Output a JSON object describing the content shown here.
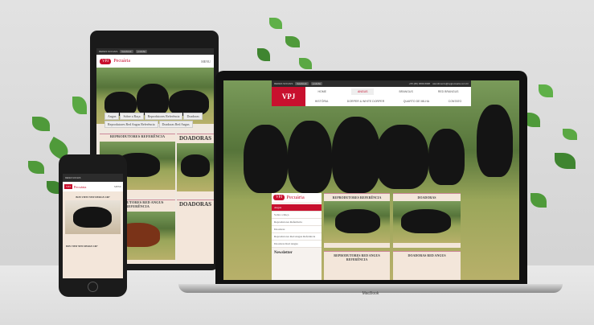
{
  "site": {
    "brand": "VPJ",
    "brand_sub": "Pecuária",
    "topbar_label": "REDES SOCIAIS",
    "facebook": "facebook",
    "youtube": "youtube",
    "phone": "+55 (##) 3###-####",
    "email": "atendimento@vpjpecuaria.com.br"
  },
  "laptop": {
    "label": "MacBook",
    "nav_row1": [
      "HOME",
      "ANGUS",
      "BRANGUS",
      "RED BRANGUS"
    ],
    "nav_row2": [
      "HISTÓRIA",
      "DORPER & WHITE DORPER",
      "QUARTO DE MILHA",
      "CONTATO"
    ],
    "menu": [
      "Angus",
      "Sobre a Raça",
      "Reprodutores Referência",
      "Doadoras",
      "Reprodutores Red Angus Referência",
      "Doadoras Red Angus"
    ],
    "newsletter": "Newsletter",
    "cards": [
      "REPRODUTORES REFERÊNCIA",
      "DOADORAS",
      "REPRODUTORES RED ANGUS REFERÊNCIA",
      "DOADORAS RED ANGUS"
    ]
  },
  "tablet": {
    "menu_label": "MENU",
    "tabs": [
      "Angus",
      "Sobre a Raça",
      "Reprodutores Referência",
      "Doadoras",
      "Reprodutores Red Angus Referência",
      "Doadoras Red Angus"
    ],
    "cards": [
      "REPRODUTORES REFERÊNCIA",
      "DOADORAS",
      "REPRODUTORES RED ANGUS REFERÊNCIA",
      "DOADORAS"
    ]
  },
  "phone": {
    "menu_label": "MENU",
    "title": "BON VIEW NEW DESIGN 1407",
    "pedigree_title": "BON VIEW NEW DESIGN 1407"
  }
}
